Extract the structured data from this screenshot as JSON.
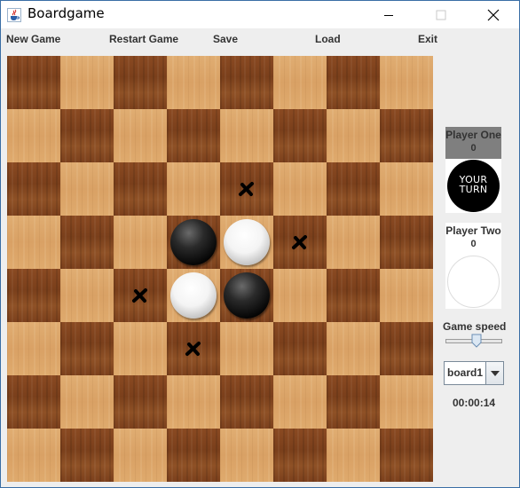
{
  "window": {
    "title": "Boardgame"
  },
  "menu": [
    {
      "id": "new",
      "label": "New Game"
    },
    {
      "id": "restart",
      "label": "Restart Game"
    },
    {
      "id": "save",
      "label": "Save"
    },
    {
      "id": "load",
      "label": "Load"
    },
    {
      "id": "exit",
      "label": "Exit"
    }
  ],
  "board": {
    "size": 8,
    "pieces": [
      {
        "row": 3,
        "col": 3,
        "color": "black"
      },
      {
        "row": 3,
        "col": 4,
        "color": "white"
      },
      {
        "row": 4,
        "col": 3,
        "color": "white"
      },
      {
        "row": 4,
        "col": 4,
        "color": "black"
      }
    ],
    "hints": [
      {
        "row": 2,
        "col": 4
      },
      {
        "row": 3,
        "col": 5
      },
      {
        "row": 4,
        "col": 2
      },
      {
        "row": 5,
        "col": 3
      }
    ]
  },
  "players": {
    "one": {
      "name": "Player One",
      "score": "0",
      "disc_color": "black",
      "turn_text": "YOUR TURN"
    },
    "two": {
      "name": "Player Two",
      "score": "0",
      "disc_color": "white"
    }
  },
  "speed": {
    "label": "Game speed",
    "value": 0.55
  },
  "board_select": {
    "value": "board1"
  },
  "timer": {
    "value": "00:00:14"
  }
}
